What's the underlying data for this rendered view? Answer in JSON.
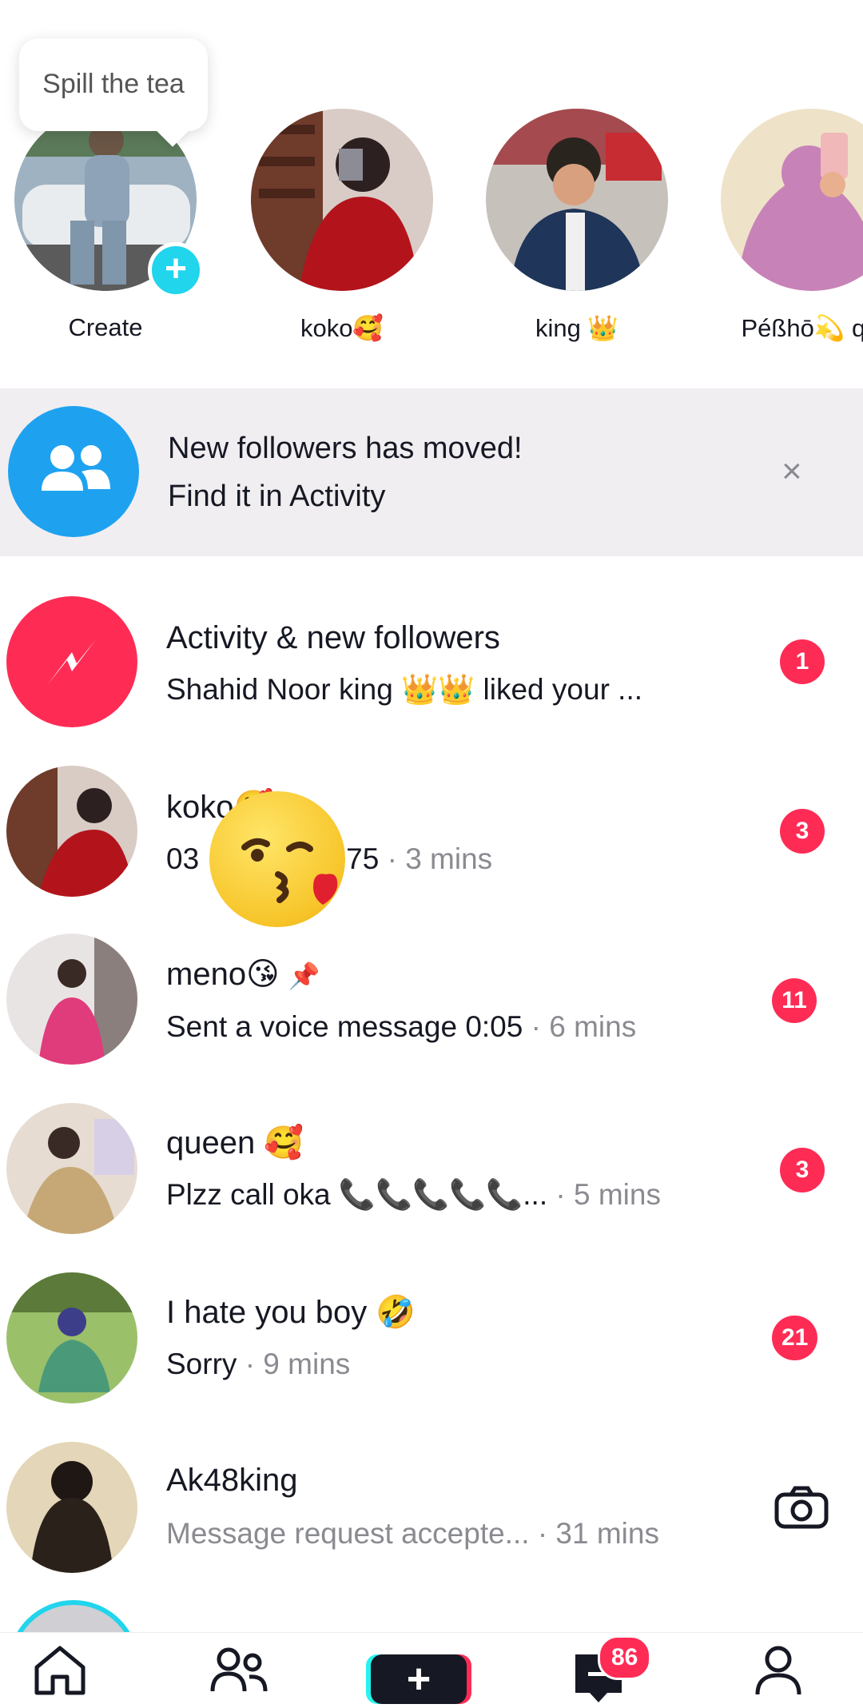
{
  "tooltip": "Spill the tea",
  "stories": [
    {
      "label": "Create"
    },
    {
      "label": "koko🥰"
    },
    {
      "label": "king 👑"
    },
    {
      "label": "Péßhō💫 qù"
    }
  ],
  "banner": {
    "line1": "New followers has moved!",
    "line2": "Find it in Activity",
    "close": "×"
  },
  "conversations": [
    {
      "title": "Activity & new followers",
      "message": "Shahid Noor king 👑👑 liked your ...",
      "time": "",
      "badge": "1"
    },
    {
      "title": "koko🥰",
      "message": "03",
      "message_tail": "75",
      "time": "· 3 mins",
      "badge": "3"
    },
    {
      "title": "meno😘",
      "message": "Sent a voice message 0:05",
      "time": "· 6 mins",
      "badge": "11"
    },
    {
      "title": "queen 🥰",
      "message": "Plzz call oka 📞📞📞📞📞...",
      "time": "· 5 mins",
      "badge": "3"
    },
    {
      "title": "I hate you boy 🤣",
      "message": "Sorry",
      "time": "· 9 mins",
      "badge": "21"
    },
    {
      "title": "Ak48king",
      "message": "Message request accepte...",
      "time": "· 31 mins",
      "badge": ""
    }
  ],
  "nav": {
    "inbox_badge": "86"
  },
  "colors": {
    "accent": "#fe2c55",
    "activity_icon": "#fe2c55",
    "banner_icon": "#1ea2f0",
    "story_plus": "#20d5ec"
  }
}
